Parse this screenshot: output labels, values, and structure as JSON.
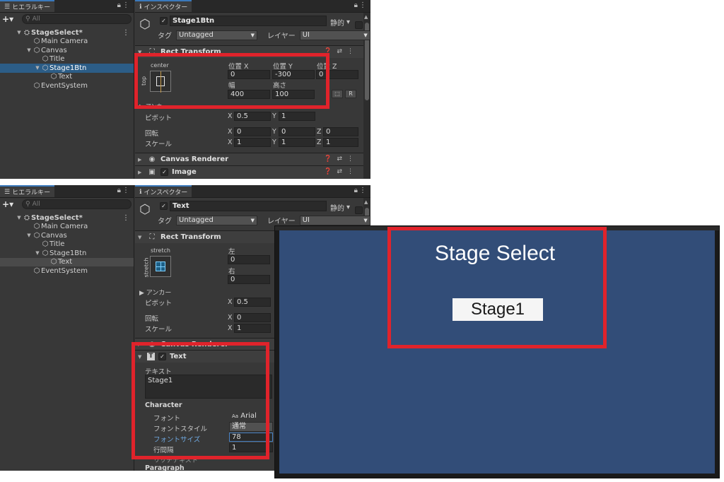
{
  "panel1": {
    "hierarchy_tab": "ヒエラルキー",
    "search_placeholder": "All",
    "plus": "+",
    "tree": [
      {
        "label": "StageSelect*",
        "bold": true,
        "arrow": "▼",
        "icon": "⛭"
      },
      {
        "label": "Main Camera",
        "icon": "⬡"
      },
      {
        "label": "Canvas",
        "arrow": "▼",
        "icon": "⬡"
      },
      {
        "label": "Title",
        "icon": "⬡"
      },
      {
        "label": "Stage1Btn",
        "arrow": "▼",
        "icon": "⬡",
        "selected": true
      },
      {
        "label": "Text",
        "icon": "⬡"
      },
      {
        "label": "EventSystem",
        "icon": "⬡"
      }
    ],
    "inspector_tab": "インスペクター",
    "object_name": "Stage1Btn",
    "static_label": "静的",
    "tag_label": "タグ",
    "tag_value": "Untagged",
    "layer_label": "レイヤー",
    "layer_value": "UI",
    "rect_transform": "Rect Transform",
    "anchor_preset_top": "center",
    "anchor_preset_side": "top",
    "pos_x_label": "位置 X",
    "pos_y_label": "位置 Y",
    "pos_z_label": "位置 Z",
    "pos_x": "0",
    "pos_y": "-300",
    "pos_z": "0",
    "width_label": "幅",
    "height_label": "高さ",
    "width": "400",
    "height": "100",
    "r_button": "R",
    "anchor_label": "アンカー",
    "pivot_label": "ピボット",
    "pivot_x": "0.5",
    "pivot_y": "1",
    "rotation_label": "回転",
    "rot_x": "0",
    "rot_y": "0",
    "rot_z": "0",
    "scale_label": "スケール",
    "scale_x": "1",
    "scale_y": "1",
    "scale_z": "1",
    "canvas_renderer": "Canvas Renderer",
    "image": "Image",
    "x": "X",
    "y": "Y",
    "z": "Z"
  },
  "panel2": {
    "hierarchy_tab": "ヒエラルキー",
    "search_placeholder": "All",
    "plus": "+",
    "tree": [
      {
        "label": "StageSelect*",
        "bold": true,
        "arrow": "▼",
        "icon": "⛭"
      },
      {
        "label": "Main Camera",
        "icon": "⬡"
      },
      {
        "label": "Canvas",
        "arrow": "▼",
        "icon": "⬡"
      },
      {
        "label": "Title",
        "icon": "⬡"
      },
      {
        "label": "Stage1Btn",
        "arrow": "▼",
        "icon": "⬡"
      },
      {
        "label": "Text",
        "icon": "⬡",
        "highlight": true
      },
      {
        "label": "EventSystem",
        "icon": "⬡"
      }
    ],
    "inspector_tab": "インスペクター",
    "object_name": "Text",
    "static_label": "静的",
    "tag_label": "タグ",
    "tag_value": "Untagged",
    "layer_label": "レイヤー",
    "layer_value": "UI",
    "rect_transform": "Rect Transform",
    "anchor_preset_top": "stretch",
    "anchor_preset_side": "stretch",
    "left_label": "左",
    "right_label": "右",
    "left": "0",
    "right": "0",
    "anchor_label": "アンカー",
    "pivot_label": "ピボット",
    "pivot_x": "0.5",
    "rotation_label": "回転",
    "rot_x": "0",
    "scale_label": "スケール",
    "scale_x": "1",
    "canvas_renderer": "Canvas Renderer",
    "text_component": "Text",
    "text_label": "テキスト",
    "text_value": "Stage1",
    "character_label": "Character",
    "font_label": "フォント",
    "font_value": "Arial",
    "font_style_label": "フォントスタイル",
    "font_style_value": "通常",
    "font_size_label": "フォントサイズ",
    "font_size_value": "78",
    "line_spacing_label": "行間隔",
    "line_spacing_value": "1",
    "rich_text_label": "リッチテキスト",
    "paragraph_label": "Paragraph",
    "x": "X"
  },
  "game": {
    "title": "Stage Select",
    "button": "Stage1",
    "bg_color": "#324d78"
  },
  "colors": {
    "highlight_red": "#e0232b",
    "editor_bg": "#383838",
    "selection": "#2c5d87"
  }
}
